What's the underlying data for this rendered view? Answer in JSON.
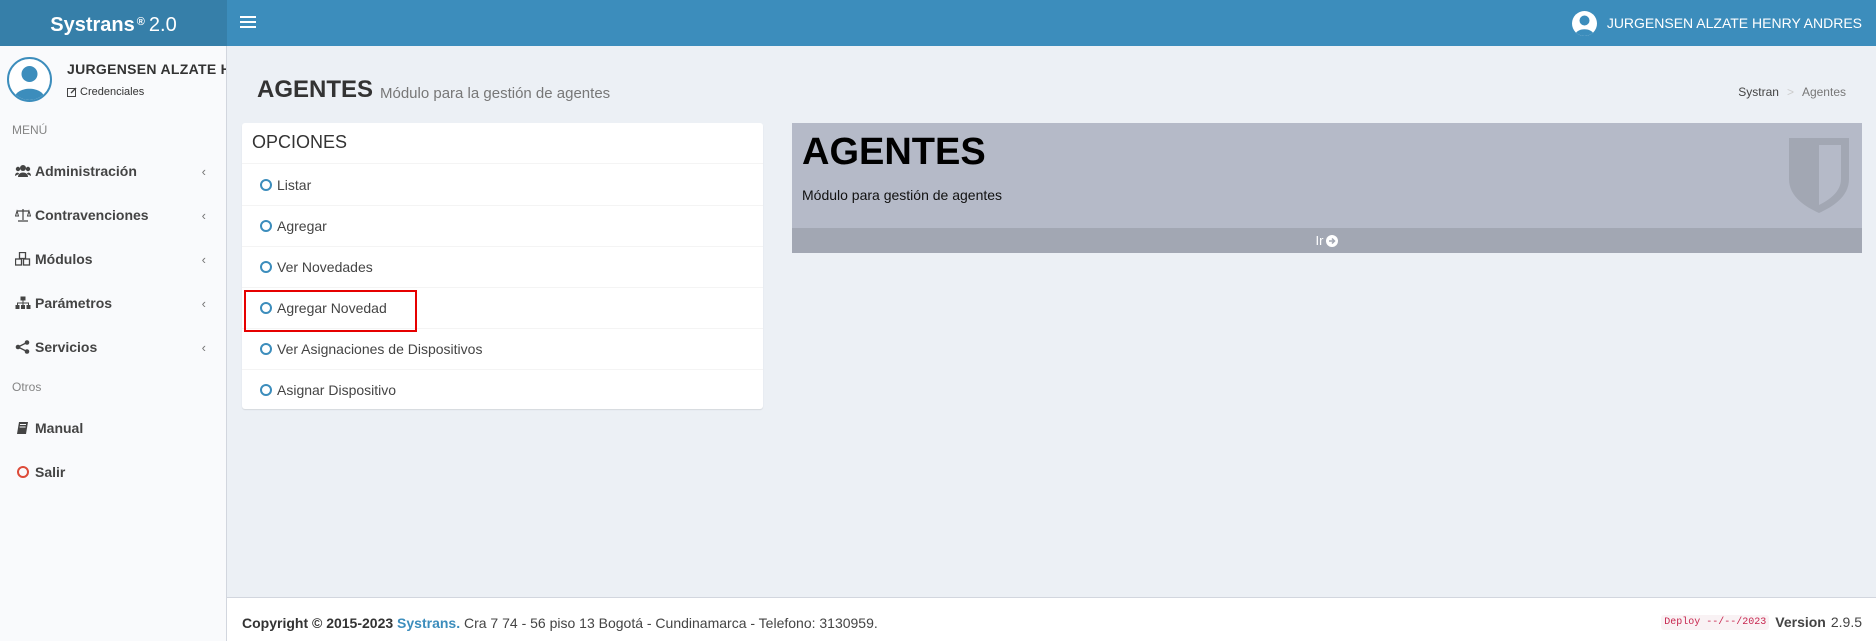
{
  "header": {
    "brand": "Systrans",
    "reg": "®",
    "version": "2.0",
    "user_name": "JURGENSEN ALZATE HENRY ANDRES"
  },
  "sidebar": {
    "user_name": "JURGENSEN ALZATE H",
    "credentials_label": "Credenciales",
    "menu_heading": "MENÚ",
    "items": [
      {
        "label": "Administración",
        "icon": "users-icon"
      },
      {
        "label": "Contravenciones",
        "icon": "balance-scale-icon"
      },
      {
        "label": "Módulos",
        "icon": "cubes-icon"
      },
      {
        "label": "Parámetros",
        "icon": "sitemap-icon"
      },
      {
        "label": "Servicios",
        "icon": "share-icon"
      }
    ],
    "others_heading": "Otros",
    "other_items": [
      {
        "label": "Manual",
        "icon": "book-icon"
      },
      {
        "label": "Salir",
        "icon": "circle-icon",
        "color": "#dd4b39"
      }
    ]
  },
  "page": {
    "title": "AGENTES",
    "subtitle": "Módulo para la gestión de agentes",
    "breadcrumb": [
      "Systran",
      "Agentes"
    ]
  },
  "options": {
    "title": "OPCIONES",
    "items": [
      "Listar",
      "Agregar",
      "Ver Novedades",
      "Agregar Novedad",
      "Ver Asignaciones de Dispositivos",
      "Asignar Dispositivo"
    ],
    "highlighted": "Agregar Novedad"
  },
  "card": {
    "title": "AGENTES",
    "description": "Módulo para gestión de agentes",
    "link_label": "Ir",
    "icon": "shield-icon"
  },
  "footer": {
    "copyright": "Copyright © 2015-2023",
    "company": "Systrans.",
    "address": "Cra 7 74 - 56 piso 13 Bogotá - Cundinamarca - Telefono: 3130959.",
    "deploy": "Deploy --/--/2023",
    "version_label": "Version",
    "version": "2.9.5"
  },
  "colors": {
    "header": "#3c8dbc",
    "logo": "#367fa9",
    "card": "#b5bac8",
    "highlight": "#e60000"
  }
}
